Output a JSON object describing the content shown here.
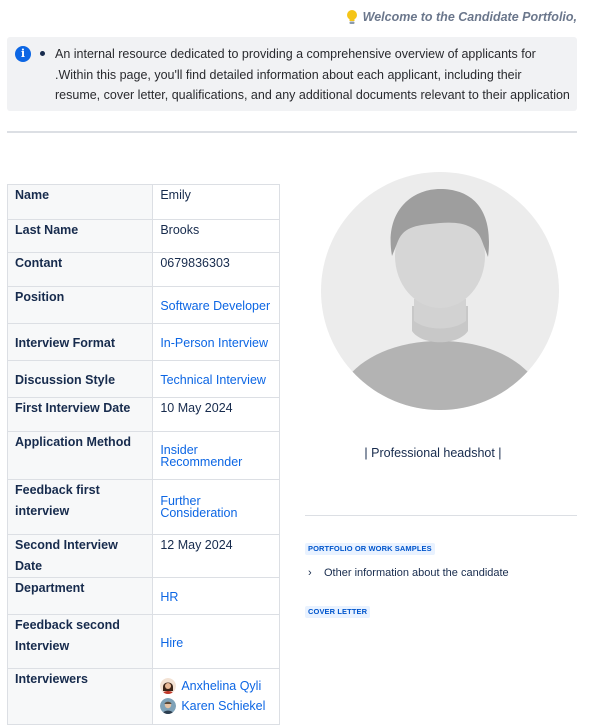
{
  "header": {
    "welcome_text": "Welcome to the Candidate Portfolio,",
    "bulb_icon": "light-bulb-icon"
  },
  "info_panel": {
    "icon": "info-icon",
    "text": "An internal resource dedicated to providing a comprehensive overview of applicants for .Within this page, you'll find detailed information about each applicant, including their resume, cover letter, qualifications, and any additional documents relevant to their application"
  },
  "details": {
    "name": {
      "label": "Name",
      "value": "Emily"
    },
    "last_name": {
      "label": "Last Name",
      "value": "Brooks"
    },
    "contact": {
      "label": "Contant",
      "value": "0679836303"
    },
    "position": {
      "label": "Position",
      "value": "Software Developer"
    },
    "interview_format": {
      "label": "Interview Format",
      "value": "In-Person Interview"
    },
    "discussion_style": {
      "label": "Discussion Style",
      "value": "Technical Interview"
    },
    "first_interview_date": {
      "label": "First Interview Date",
      "value": "10 May 2024"
    },
    "application_method": {
      "label": "Application Method",
      "value_line1": "Insider",
      "value_line2": "Recommender"
    },
    "feedback_first": {
      "label": "Feedback first interview",
      "value_line1": "Further",
      "value_line2": "Consideration"
    },
    "second_interview_date": {
      "label": "Second Interview Date",
      "value": "12 May 2024"
    },
    "department": {
      "label": "Department",
      "value": "HR"
    },
    "feedback_second": {
      "label": "Feedback second Interview",
      "value": "Hire"
    },
    "interviewers": {
      "label": "Interviewers",
      "people": [
        "Anxhelina Qyli",
        "Karen Schiekel"
      ]
    }
  },
  "headshot": {
    "caption": "| Professional headshot |",
    "icon": "default-avatar-icon"
  },
  "portfolio": {
    "heading": "PORTFOLIO OR WORK SAMPLES",
    "expand_label": "Other information about the candidate"
  },
  "cover_letter": {
    "heading": "COVER LETTER"
  },
  "colors": {
    "link": "#0c66e4",
    "info_icon": "#0c66e4",
    "panel_bg": "#f1f2f4",
    "lozenge_bg": "#e9f2ff",
    "lozenge_text": "#0055cc"
  }
}
